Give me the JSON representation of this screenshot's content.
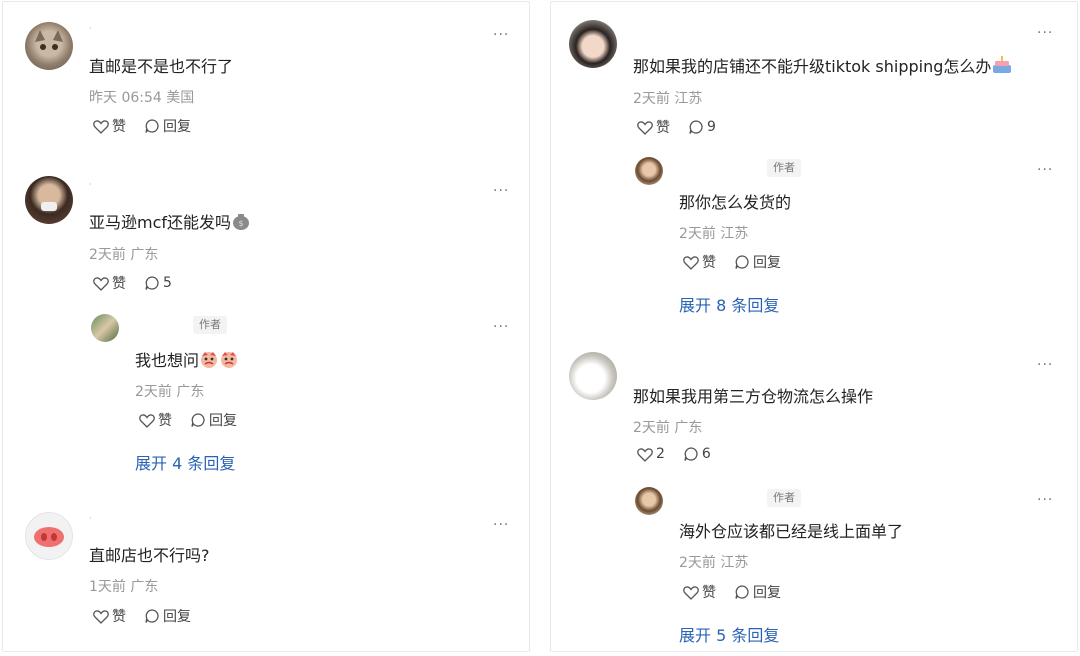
{
  "labels": {
    "like": "赞",
    "reply": "回复",
    "author": "作者"
  },
  "left": {
    "c1": {
      "text": "直邮是不是也不行了",
      "meta": "昨天 06:54 美国"
    },
    "c2": {
      "text": "亚马逊mcf还能发吗",
      "meta": "2天前 广东",
      "reply_count": "5",
      "reply": {
        "text": "我也想问",
        "meta": "2天前 广东"
      },
      "expand": "展开 4 条回复"
    },
    "c3": {
      "text": "直邮店也不行吗?",
      "meta": "1天前 广东"
    }
  },
  "right": {
    "c1": {
      "text": "那如果我的店铺还不能升级tiktok shipping怎么办",
      "meta": "2天前 江苏",
      "reply_count": "9",
      "reply": {
        "text": "那你怎么发货的",
        "meta": "2天前 江苏"
      },
      "expand": "展开 8 条回复"
    },
    "c2": {
      "text": "那如果我用第三方仓物流怎么操作",
      "meta": "2天前 广东",
      "like_count": "2",
      "reply_count": "6",
      "reply": {
        "text": "海外仓应该都已经是线上面单了",
        "meta": "2天前 江苏"
      },
      "expand": "展开 5 条回复"
    }
  },
  "colors": {
    "link": "#2a63b5",
    "meta": "#999999",
    "text": "#222222"
  }
}
